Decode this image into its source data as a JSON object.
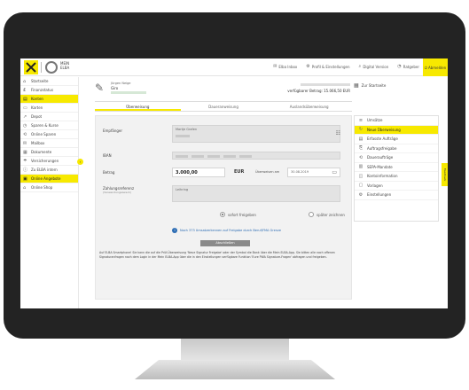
{
  "app": {
    "brand_line1": "MEIN",
    "brand_line2": "ELBA",
    "colors": {
      "accent": "#f7e900",
      "link": "#2a6bb3",
      "frame": "#232323"
    }
  },
  "topbar": {
    "links": [
      {
        "icon": "inbox-icon",
        "glyph": "✉",
        "label": "Elba Inbox"
      },
      {
        "icon": "gear-icon",
        "glyph": "⚙",
        "label": "Profil & Einstellungen"
      },
      {
        "icon": "search-icon",
        "glyph": "⌕",
        "label": "Digital Version"
      },
      {
        "icon": "chat-icon",
        "glyph": "◔",
        "label": "Ratgeber"
      }
    ],
    "logout": "Abmelden"
  },
  "sidebar": {
    "items": [
      {
        "icon": "home-icon",
        "glyph": "⌂",
        "label": "Startseite"
      },
      {
        "icon": "finance-icon",
        "glyph": "₤",
        "label": "Finanzstatus"
      },
      {
        "icon": "konten-icon",
        "glyph": "▤",
        "label": "Konten"
      },
      {
        "icon": "card-icon",
        "glyph": "▭",
        "label": "Karten"
      },
      {
        "icon": "chart-icon",
        "glyph": "↗",
        "label": "Depot"
      },
      {
        "icon": "save-icon",
        "glyph": "◷",
        "label": "Sparen & Kurse"
      },
      {
        "icon": "online-icon",
        "glyph": "⟲",
        "label": "Online Sparen"
      },
      {
        "icon": "mailbox-icon",
        "glyph": "✉",
        "label": "Mailbox"
      },
      {
        "icon": "document-icon",
        "glyph": "▦",
        "label": "Dokumente"
      },
      {
        "icon": "insurance-icon",
        "glyph": "☂",
        "label": "Versicherungen"
      },
      {
        "icon": "info-icon",
        "glyph": "ⓘ",
        "label": "Zu ELBA intern"
      },
      {
        "icon": "angebote-icon",
        "glyph": "▣",
        "label": "Online Angebote"
      },
      {
        "icon": "shop-icon",
        "glyph": "⌂",
        "label": "Online Shop"
      }
    ],
    "active_index": 2
  },
  "account": {
    "name": "Jürgen Neige",
    "type": "Giro",
    "balance_label": "verfügbarer Betrag: 15.066,50 EUR"
  },
  "startseite": "Zur Startseite",
  "tabs": {
    "items": [
      "Überweisung",
      "Daueranweisung",
      "Auslandsüberweisung"
    ],
    "active_index": 0
  },
  "form": {
    "empfaenger_label": "Empfänger",
    "empfaenger_value": "Martje Grafen",
    "iban_label": "IBAN",
    "betrag_label": "Betrag",
    "betrag_value": "3.000,00",
    "currency": "EUR",
    "date_label": "Überweisen am",
    "date_value": "30.08.2019",
    "zweck_label": "Zahlungsreferenz",
    "zweck_sub": "(Verwendungszweck)",
    "zweck_value": "Leihring",
    "radio_left": "sofort freigeben",
    "radio_right": "später zeichnen",
    "hint": "Noch 373 Umsatzerkennen auf Freigabe durch Beruf/FMA Grenze",
    "submit": "Abschließen",
    "note": "Auf ELBA Smartphone! Sie kann die auf die Prüf-Überweisung 'Neue Signatur Freigabe' oder der Symbol die Bank über die Mein ELBA-App. Sie bitten alle nach offenen Signaturanfragen nach dem Login in der Mein ELBA-App über die in den Einstellungen verfügbare Funktion 'Eure PWA Signature-Fragen' abfragen und freigeben."
  },
  "right_menu": {
    "items": [
      {
        "icon": "list-icon",
        "glyph": "≡",
        "label": "Umsätze"
      },
      {
        "icon": "transfer-icon",
        "glyph": "↻",
        "label": "Neue Überweisung"
      },
      {
        "icon": "orders-icon",
        "glyph": "▤",
        "label": "Erfasste Aufträge"
      },
      {
        "icon": "orders-approve-icon",
        "glyph": "⎘",
        "label": "Auftragsfreigabe"
      },
      {
        "icon": "standing-icon",
        "glyph": "⟲",
        "label": "Daueraufträge"
      },
      {
        "icon": "sepa-icon",
        "glyph": "▥",
        "label": "SEPA-Mandate"
      },
      {
        "icon": "statement-icon",
        "glyph": "◫",
        "label": "Kontoinformation"
      },
      {
        "icon": "template-icon",
        "glyph": "▢",
        "label": "Vorlagen"
      },
      {
        "icon": "settings-icon",
        "glyph": "⚙",
        "label": "Einstellungen"
      }
    ],
    "active_index": 1
  },
  "feedback": "Feedback"
}
